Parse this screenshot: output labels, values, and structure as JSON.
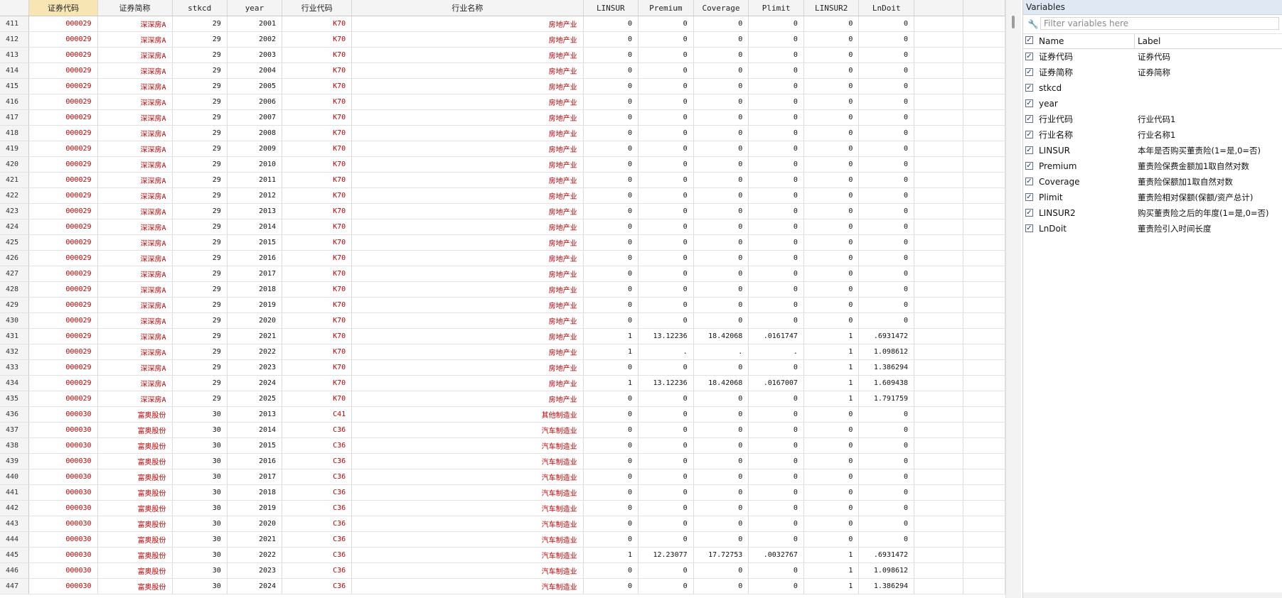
{
  "grid": {
    "columns": [
      {
        "label": "证券代码",
        "selected": true
      },
      {
        "label": "证券简称"
      },
      {
        "label": "stkcd"
      },
      {
        "label": "year"
      },
      {
        "label": "行业代码"
      },
      {
        "label": "行业名称"
      },
      {
        "label": "LINSUR"
      },
      {
        "label": "Premium"
      },
      {
        "label": "Coverage"
      },
      {
        "label": "Plimit"
      },
      {
        "label": "LINSUR2"
      },
      {
        "label": "LnDoit"
      }
    ],
    "rows": [
      [
        "411",
        "000029",
        "深深房A",
        "29",
        "2001",
        "K70",
        "房地产业",
        "0",
        "0",
        "0",
        "0",
        "0",
        "0"
      ],
      [
        "412",
        "000029",
        "深深房A",
        "29",
        "2002",
        "K70",
        "房地产业",
        "0",
        "0",
        "0",
        "0",
        "0",
        "0"
      ],
      [
        "413",
        "000029",
        "深深房A",
        "29",
        "2003",
        "K70",
        "房地产业",
        "0",
        "0",
        "0",
        "0",
        "0",
        "0"
      ],
      [
        "414",
        "000029",
        "深深房A",
        "29",
        "2004",
        "K70",
        "房地产业",
        "0",
        "0",
        "0",
        "0",
        "0",
        "0"
      ],
      [
        "415",
        "000029",
        "深深房A",
        "29",
        "2005",
        "K70",
        "房地产业",
        "0",
        "0",
        "0",
        "0",
        "0",
        "0"
      ],
      [
        "416",
        "000029",
        "深深房A",
        "29",
        "2006",
        "K70",
        "房地产业",
        "0",
        "0",
        "0",
        "0",
        "0",
        "0"
      ],
      [
        "417",
        "000029",
        "深深房A",
        "29",
        "2007",
        "K70",
        "房地产业",
        "0",
        "0",
        "0",
        "0",
        "0",
        "0"
      ],
      [
        "418",
        "000029",
        "深深房A",
        "29",
        "2008",
        "K70",
        "房地产业",
        "0",
        "0",
        "0",
        "0",
        "0",
        "0"
      ],
      [
        "419",
        "000029",
        "深深房A",
        "29",
        "2009",
        "K70",
        "房地产业",
        "0",
        "0",
        "0",
        "0",
        "0",
        "0"
      ],
      [
        "420",
        "000029",
        "深深房A",
        "29",
        "2010",
        "K70",
        "房地产业",
        "0",
        "0",
        "0",
        "0",
        "0",
        "0"
      ],
      [
        "421",
        "000029",
        "深深房A",
        "29",
        "2011",
        "K70",
        "房地产业",
        "0",
        "0",
        "0",
        "0",
        "0",
        "0"
      ],
      [
        "422",
        "000029",
        "深深房A",
        "29",
        "2012",
        "K70",
        "房地产业",
        "0",
        "0",
        "0",
        "0",
        "0",
        "0"
      ],
      [
        "423",
        "000029",
        "深深房A",
        "29",
        "2013",
        "K70",
        "房地产业",
        "0",
        "0",
        "0",
        "0",
        "0",
        "0"
      ],
      [
        "424",
        "000029",
        "深深房A",
        "29",
        "2014",
        "K70",
        "房地产业",
        "0",
        "0",
        "0",
        "0",
        "0",
        "0"
      ],
      [
        "425",
        "000029",
        "深深房A",
        "29",
        "2015",
        "K70",
        "房地产业",
        "0",
        "0",
        "0",
        "0",
        "0",
        "0"
      ],
      [
        "426",
        "000029",
        "深深房A",
        "29",
        "2016",
        "K70",
        "房地产业",
        "0",
        "0",
        "0",
        "0",
        "0",
        "0"
      ],
      [
        "427",
        "000029",
        "深深房A",
        "29",
        "2017",
        "K70",
        "房地产业",
        "0",
        "0",
        "0",
        "0",
        "0",
        "0"
      ],
      [
        "428",
        "000029",
        "深深房A",
        "29",
        "2018",
        "K70",
        "房地产业",
        "0",
        "0",
        "0",
        "0",
        "0",
        "0"
      ],
      [
        "429",
        "000029",
        "深深房A",
        "29",
        "2019",
        "K70",
        "房地产业",
        "0",
        "0",
        "0",
        "0",
        "0",
        "0"
      ],
      [
        "430",
        "000029",
        "深深房A",
        "29",
        "2020",
        "K70",
        "房地产业",
        "0",
        "0",
        "0",
        "0",
        "0",
        "0"
      ],
      [
        "431",
        "000029",
        "深深房A",
        "29",
        "2021",
        "K70",
        "房地产业",
        "1",
        "13.12236",
        "18.42068",
        ".0161747",
        "1",
        ".6931472"
      ],
      [
        "432",
        "000029",
        "深深房A",
        "29",
        "2022",
        "K70",
        "房地产业",
        "1",
        ".",
        ".",
        ".",
        "1",
        "1.098612"
      ],
      [
        "433",
        "000029",
        "深深房A",
        "29",
        "2023",
        "K70",
        "房地产业",
        "0",
        "0",
        "0",
        "0",
        "1",
        "1.386294"
      ],
      [
        "434",
        "000029",
        "深深房A",
        "29",
        "2024",
        "K70",
        "房地产业",
        "1",
        "13.12236",
        "18.42068",
        ".0167007",
        "1",
        "1.609438"
      ],
      [
        "435",
        "000029",
        "深深房A",
        "29",
        "2025",
        "K70",
        "房地产业",
        "0",
        "0",
        "0",
        "0",
        "1",
        "1.791759"
      ],
      [
        "436",
        "000030",
        "富奥股份",
        "30",
        "2013",
        "C41",
        "其他制造业",
        "0",
        "0",
        "0",
        "0",
        "0",
        "0"
      ],
      [
        "437",
        "000030",
        "富奥股份",
        "30",
        "2014",
        "C36",
        "汽车制造业",
        "0",
        "0",
        "0",
        "0",
        "0",
        "0"
      ],
      [
        "438",
        "000030",
        "富奥股份",
        "30",
        "2015",
        "C36",
        "汽车制造业",
        "0",
        "0",
        "0",
        "0",
        "0",
        "0"
      ],
      [
        "439",
        "000030",
        "富奥股份",
        "30",
        "2016",
        "C36",
        "汽车制造业",
        "0",
        "0",
        "0",
        "0",
        "0",
        "0"
      ],
      [
        "440",
        "000030",
        "富奥股份",
        "30",
        "2017",
        "C36",
        "汽车制造业",
        "0",
        "0",
        "0",
        "0",
        "0",
        "0"
      ],
      [
        "441",
        "000030",
        "富奥股份",
        "30",
        "2018",
        "C36",
        "汽车制造业",
        "0",
        "0",
        "0",
        "0",
        "0",
        "0"
      ],
      [
        "442",
        "000030",
        "富奥股份",
        "30",
        "2019",
        "C36",
        "汽车制造业",
        "0",
        "0",
        "0",
        "0",
        "0",
        "0"
      ],
      [
        "443",
        "000030",
        "富奥股份",
        "30",
        "2020",
        "C36",
        "汽车制造业",
        "0",
        "0",
        "0",
        "0",
        "0",
        "0"
      ],
      [
        "444",
        "000030",
        "富奥股份",
        "30",
        "2021",
        "C36",
        "汽车制造业",
        "0",
        "0",
        "0",
        "0",
        "0",
        "0"
      ],
      [
        "445",
        "000030",
        "富奥股份",
        "30",
        "2022",
        "C36",
        "汽车制造业",
        "1",
        "12.23077",
        "17.72753",
        ".0032767",
        "1",
        ".6931472"
      ],
      [
        "446",
        "000030",
        "富奥股份",
        "30",
        "2023",
        "C36",
        "汽车制造业",
        "0",
        "0",
        "0",
        "0",
        "1",
        "1.098612"
      ],
      [
        "447",
        "000030",
        "富奥股份",
        "30",
        "2024",
        "C36",
        "汽车制造业",
        "0",
        "0",
        "0",
        "0",
        "1",
        "1.386294"
      ]
    ]
  },
  "variables_pane": {
    "title": "Variables",
    "filter_placeholder": "Filter variables here",
    "col_name": "Name",
    "col_label": "Label",
    "variables": [
      {
        "name": "证券代码",
        "label": "证券代码"
      },
      {
        "name": "证券简称",
        "label": "证券简称"
      },
      {
        "name": "stkcd",
        "label": ""
      },
      {
        "name": "year",
        "label": ""
      },
      {
        "name": "行业代码",
        "label": "行业代码1"
      },
      {
        "name": "行业名称",
        "label": "行业名称1"
      },
      {
        "name": "LINSUR",
        "label": "本年是否购买董责险(1=是,0=否)"
      },
      {
        "name": "Premium",
        "label": "董责险保费金额加1取自然对数"
      },
      {
        "name": "Coverage",
        "label": "董责险保额加1取自然对数"
      },
      {
        "name": "Plimit",
        "label": "董责险相对保额(保额/资产总计)"
      },
      {
        "name": "LINSUR2",
        "label": "购买董责险之后的年度(1=是,0=否)"
      },
      {
        "name": "LnDoit",
        "label": "董责险引入时间长度"
      }
    ]
  },
  "icons": {
    "filter": "wrench-filter-icon",
    "checkbox": "checkbox-checked-icon"
  }
}
